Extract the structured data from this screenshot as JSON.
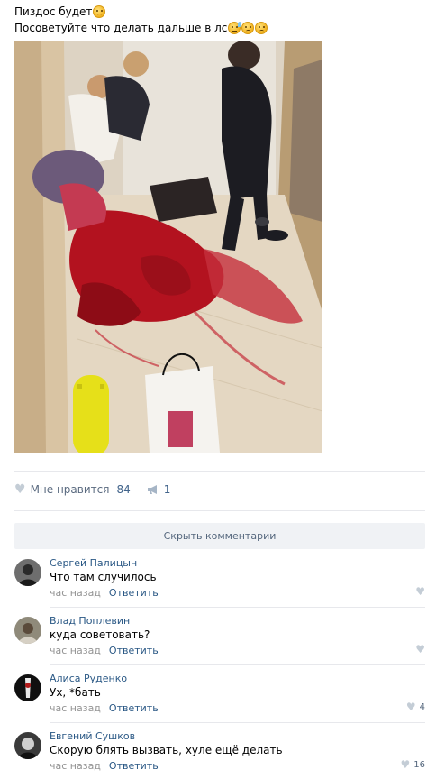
{
  "post": {
    "line1": "Пиздос будет",
    "line2": "Посоветуйте что делать дальше в лс",
    "emoji_line1": [
      "worried-face-icon"
    ],
    "emoji_line2": [
      "sweat-face-icon",
      "sad-face-icon",
      "pensive-face-icon"
    ]
  },
  "actions": {
    "like_label": "Мне нравится",
    "like_count": "84",
    "share_count": "1"
  },
  "hide_comments_label": "Скрыть комментарии",
  "comments": [
    {
      "author": "Сергей Палицын",
      "text": "Что там случилось",
      "time": "час назад",
      "reply": "Ответить",
      "likes": ""
    },
    {
      "author": "Влад Поплевин",
      "text": "куда советовать?",
      "time": "час назад",
      "reply": "Ответить",
      "likes": ""
    },
    {
      "author": "Алиса Руденко",
      "text": "Ух, *бать",
      "time": "час назад",
      "reply": "Ответить",
      "likes": "4"
    },
    {
      "author": "Евгений Сушков",
      "text": "Скорую блять вызвать, хуле ещё делать",
      "time": "час назад",
      "reply": "Ответить",
      "likes": "16"
    }
  ],
  "colors": {
    "link": "#2a5885",
    "meta": "#939393",
    "divider": "#e7e8ec"
  }
}
